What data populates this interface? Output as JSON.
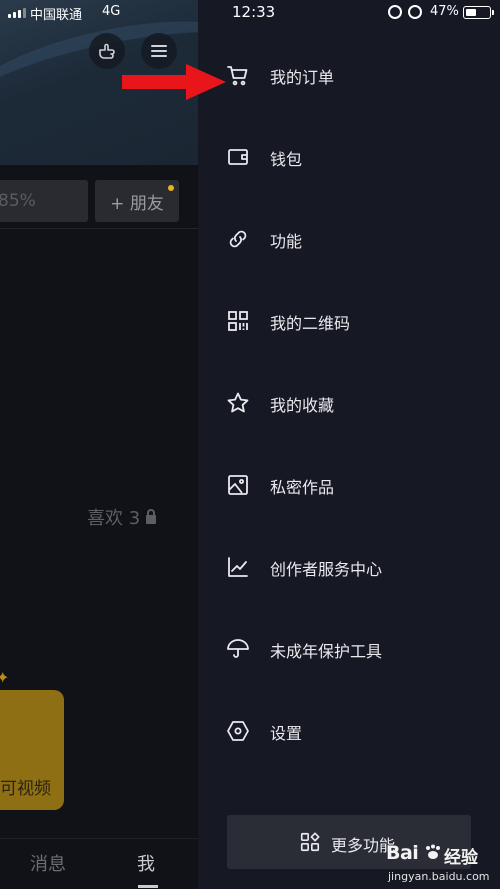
{
  "status_bar": {
    "carrier": "中国联通",
    "network": "4G",
    "time": "12:33",
    "battery_percent_text": "47%",
    "battery_level": 0.47
  },
  "profile_page": {
    "stat_partial": "85%",
    "add_friend_label": "+ 朋友",
    "likes_label": "喜欢 3",
    "video_card_label": "可视频",
    "tabs": {
      "messages": "消息",
      "me": "我"
    }
  },
  "drawer": {
    "items": [
      {
        "label": "我的订单",
        "icon": "cart-icon"
      },
      {
        "label": "钱包",
        "icon": "wallet-icon"
      },
      {
        "label": "功能",
        "icon": "link-icon"
      },
      {
        "label": "我的二维码",
        "icon": "qr-code-icon"
      },
      {
        "label": "我的收藏",
        "icon": "star-icon"
      },
      {
        "label": "私密作品",
        "icon": "image-icon"
      },
      {
        "label": "创作者服务中心",
        "icon": "chart-line-icon"
      },
      {
        "label": "未成年保护工具",
        "icon": "umbrella-icon"
      },
      {
        "label": "设置",
        "icon": "settings-hexagon-icon"
      }
    ],
    "more_button_label": "更多功能"
  },
  "watermark": {
    "brand": "Bai",
    "brand_cn": "经验",
    "url": "jingyan.baidu.com"
  },
  "colors": {
    "drawer_bg": "#161823",
    "annotation_arrow": "#e8161b",
    "accent_dot": "#e7b51f"
  }
}
